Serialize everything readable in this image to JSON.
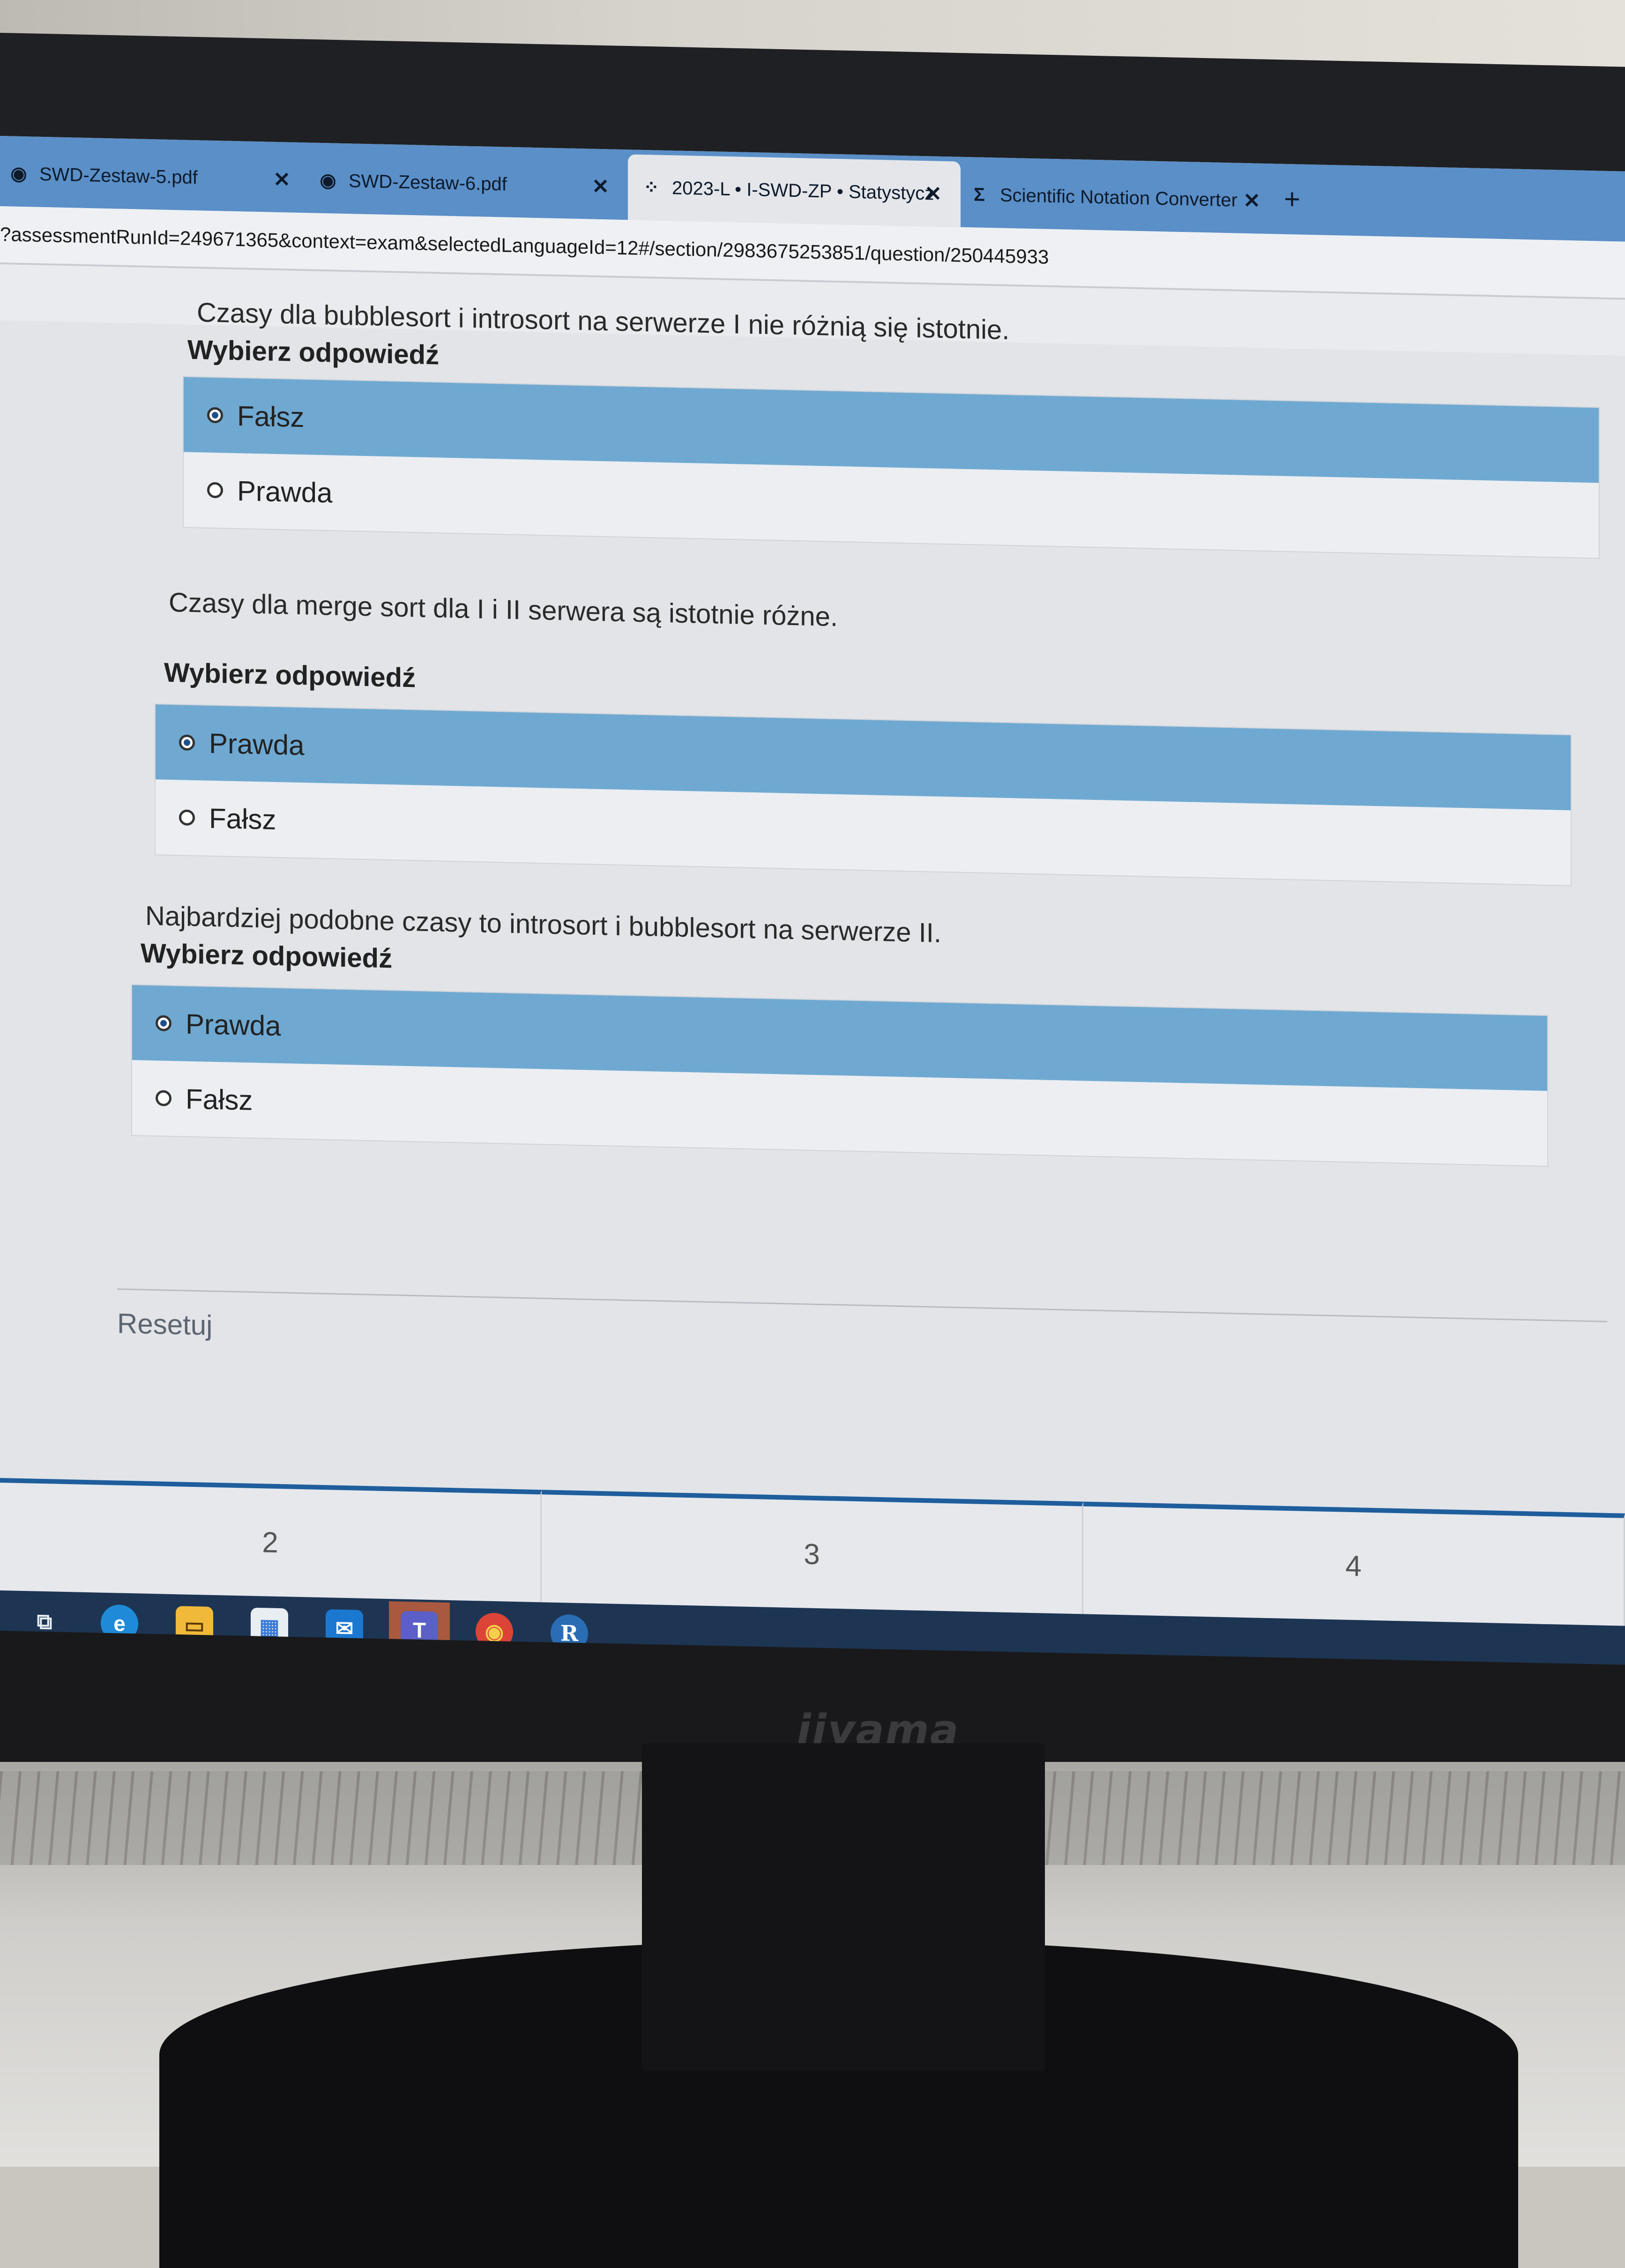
{
  "browser": {
    "tabs": [
      {
        "title": "SWD-Zestaw-5.pdf",
        "icon": "pdf-icon",
        "close": "✕"
      },
      {
        "title": "SWD-Zestaw-6.pdf",
        "icon": "pdf-icon",
        "close": "✕"
      },
      {
        "title": "2023-L • I-SWD-ZP • Statystycz",
        "icon": "course-icon",
        "close": "✕"
      },
      {
        "title": "Scientific Notation Converter",
        "icon": "sigma-icon",
        "close": "✕"
      }
    ],
    "new_tab": "+",
    "url": "?assessmentRunId=249671365&context=exam&selectedLanguageId=12#/section/2983675253851/question/250445933"
  },
  "questions": [
    {
      "text": "Czasy dla bubblesort i introsort na serwerze I nie różnią się istotnie.",
      "prompt": "Wybierz odpowiedź",
      "options": [
        {
          "label": "Fałsz",
          "selected": true
        },
        {
          "label": "Prawda",
          "selected": false
        }
      ]
    },
    {
      "text": "Czasy dla merge sort dla I i II serwera są istotnie różne.",
      "prompt": "Wybierz odpowiedź",
      "options": [
        {
          "label": "Prawda",
          "selected": true
        },
        {
          "label": "Fałsz",
          "selected": false
        }
      ]
    },
    {
      "text": "Najbardziej podobne czasy to introsort i bubblesort na serwerze II.",
      "prompt": "Wybierz odpowiedź",
      "options": [
        {
          "label": "Prawda",
          "selected": true
        },
        {
          "label": "Fałsz",
          "selected": false
        }
      ]
    }
  ],
  "reset_label": "Resetuj",
  "pagination": [
    "2",
    "3",
    "4"
  ],
  "taskbar": [
    {
      "name": "task-view-icon",
      "glyph": "⧉"
    },
    {
      "name": "edge-icon",
      "glyph": "e"
    },
    {
      "name": "file-explorer-icon",
      "glyph": "▭"
    },
    {
      "name": "store-icon",
      "glyph": "▦"
    },
    {
      "name": "mail-icon",
      "glyph": "✉"
    },
    {
      "name": "teams-icon",
      "glyph": "T"
    },
    {
      "name": "chrome-icon",
      "glyph": "◉"
    },
    {
      "name": "r-icon",
      "glyph": "R"
    }
  ],
  "monitor_brand": "iiyama",
  "colors": {
    "selected_option": "#6fa9d2",
    "tab_bar": "#5a8fc8",
    "pager_accent": "#1f5e9c",
    "taskbar": "#1d3553"
  }
}
